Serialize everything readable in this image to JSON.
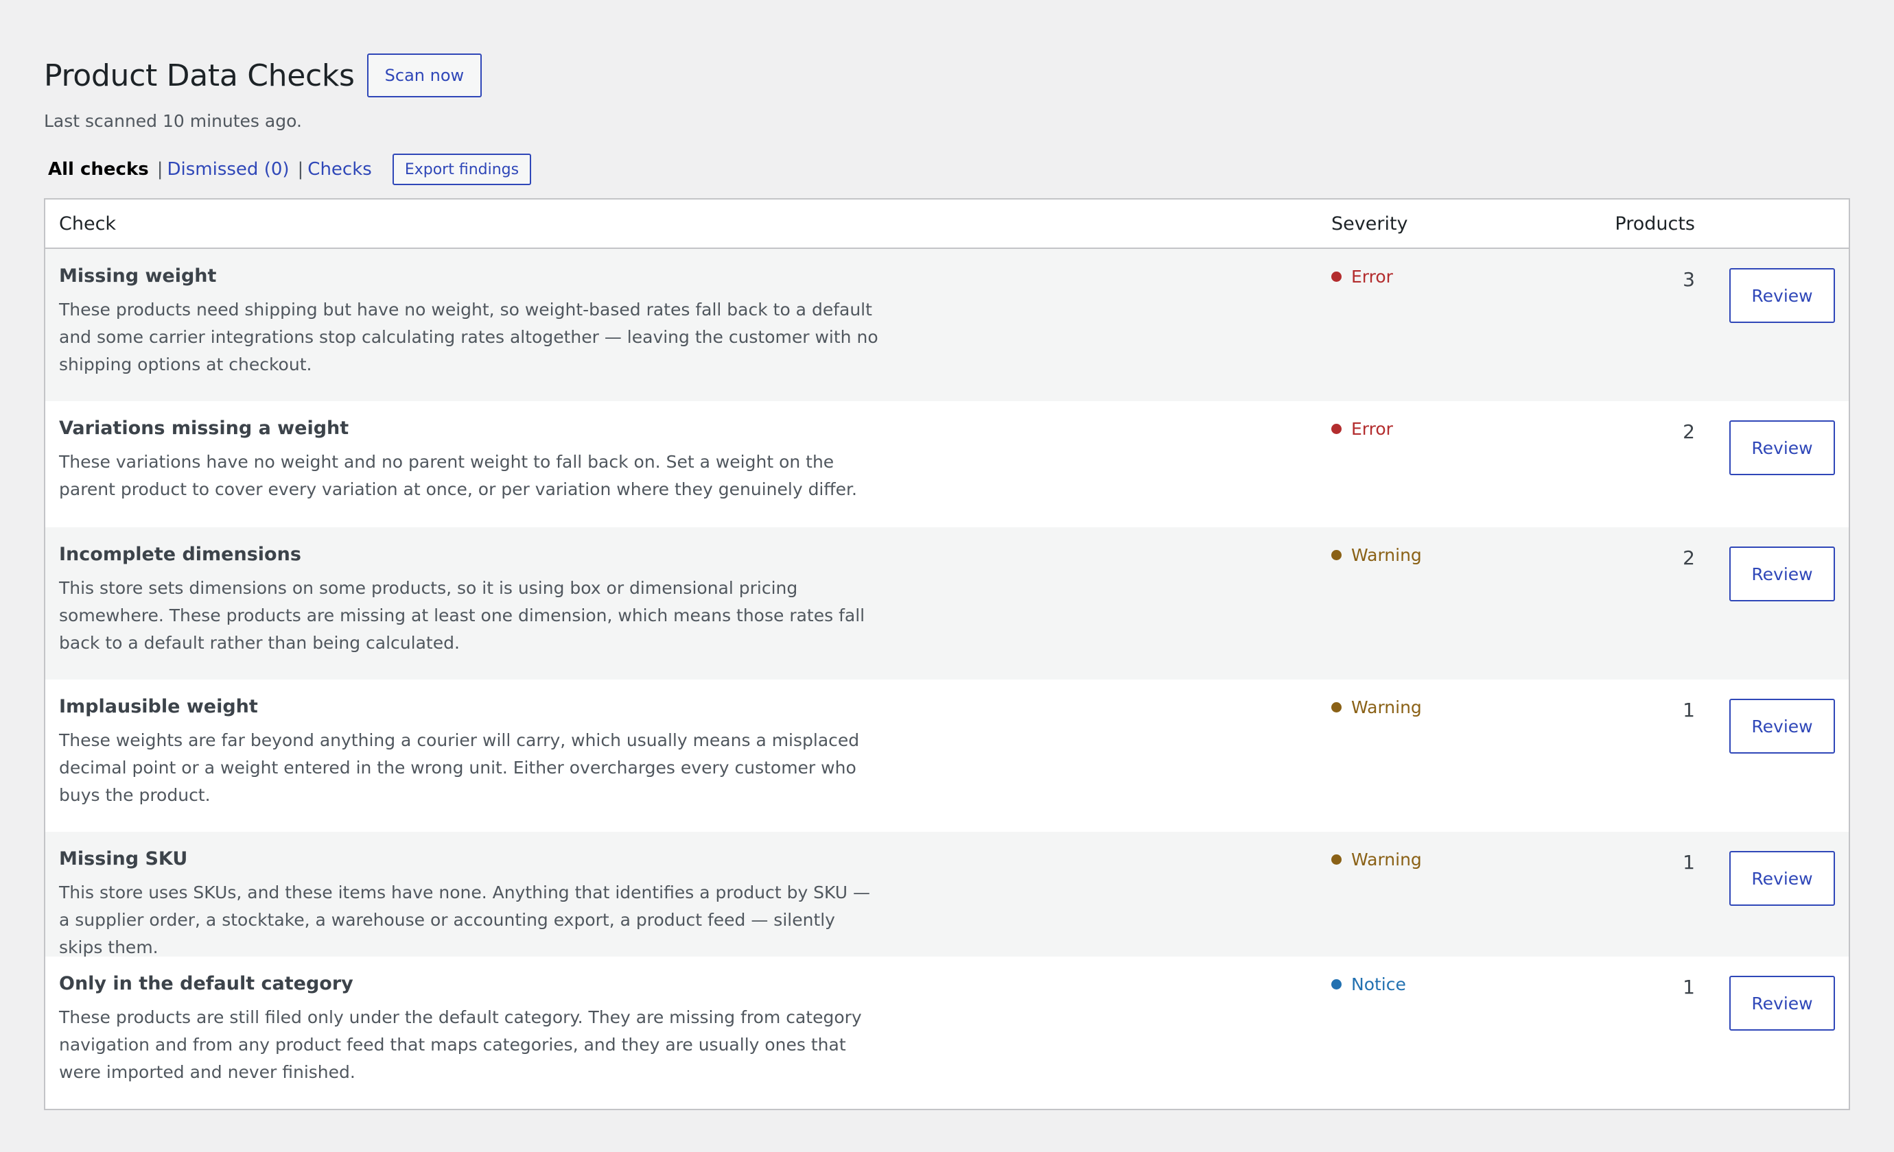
{
  "header": {
    "title": "Product Data Checks",
    "scan_button": "Scan now",
    "last_scanned": "Last scanned 10 minutes ago."
  },
  "subnav": {
    "all_checks": "All checks",
    "dismissed": "Dismissed (0)",
    "checks": "Checks",
    "export_button": "Export findings",
    "separator": "|"
  },
  "table": {
    "columns": {
      "check": "Check",
      "severity": "Severity",
      "products": "Products"
    },
    "review_label": "Review",
    "rows": [
      {
        "title": "Missing weight",
        "description": "These products need shipping but have no weight, so weight-based rates fall back to a default and some carrier integrations stop calculating rates altogether — leaving the customer with no shipping options at checkout.",
        "severity": "Error",
        "severity_color": "#b32d2e",
        "products": "3"
      },
      {
        "title": "Variations missing a weight",
        "description": "These variations have no weight and no parent weight to fall back on. Set a weight on the parent product to cover every variation at once, or per variation where they genuinely differ.",
        "severity": "Error",
        "severity_color": "#b32d2e",
        "products": "2"
      },
      {
        "title": "Incomplete dimensions",
        "description": "This store sets dimensions on some products, so it is using box or dimensional pricing somewhere. These products are missing at least one dimension, which means those rates fall back to a default rather than being calculated.",
        "severity": "Warning",
        "severity_color": "#8a6116",
        "products": "2"
      },
      {
        "title": "Implausible weight",
        "description": "These weights are far beyond anything a courier will carry, which usually means a misplaced decimal point or a weight entered in the wrong unit. Either overcharges every customer who buys the product.",
        "severity": "Warning",
        "severity_color": "#8a6116",
        "products": "1"
      },
      {
        "title": "Missing SKU",
        "description": "This store uses SKUs, and these items have none. Anything that identifies a product by SKU — a supplier order, a stocktake, a warehouse or accounting export, a product feed — silently skips them.",
        "severity": "Warning",
        "severity_color": "#8a6116",
        "products": "1"
      },
      {
        "title": "Only in the default category",
        "description": "These products are still filed only under the default category. They are missing from category navigation and from any product feed that maps categories, and they are usually ones that were imported and never finished.",
        "severity": "Notice",
        "severity_color": "#2271b1",
        "products": "1"
      }
    ]
  },
  "colors": {
    "accent": "#2f47b8",
    "background": "#f0f0f1",
    "border": "#c3c4c7"
  }
}
